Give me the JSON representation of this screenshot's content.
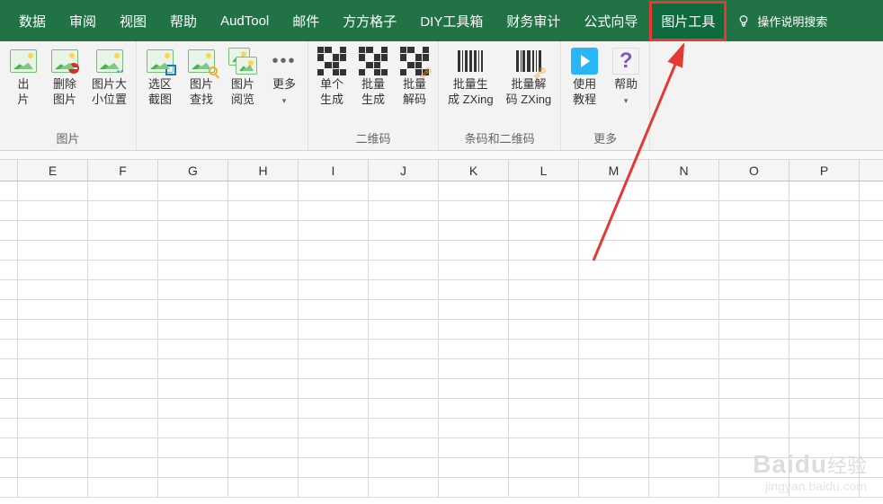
{
  "tabs": {
    "items": [
      {
        "label": "数据"
      },
      {
        "label": "审阅"
      },
      {
        "label": "视图"
      },
      {
        "label": "帮助"
      },
      {
        "label": "AudTool"
      },
      {
        "label": "邮件"
      },
      {
        "label": "方方格子"
      },
      {
        "label": "DIY工具箱"
      },
      {
        "label": "财务审计"
      },
      {
        "label": "公式向导"
      },
      {
        "label": "图片工具",
        "active": true
      }
    ],
    "search": "操作说明搜索"
  },
  "ribbon": {
    "groups": [
      {
        "label": "图片",
        "items": [
          {
            "name": "export-image",
            "label": "出\n片"
          },
          {
            "name": "delete-image",
            "label": "删除\n图片"
          },
          {
            "name": "image-size-pos",
            "label": "图片大\n小位置"
          }
        ]
      },
      {
        "label": "",
        "items": [
          {
            "name": "area-screenshot",
            "label": "选区\n截图"
          },
          {
            "name": "image-search",
            "label": "图片\n查找"
          },
          {
            "name": "image-browse",
            "label": "图片\n阅览"
          },
          {
            "name": "more-1",
            "label": "更多",
            "more": true
          }
        ]
      },
      {
        "label": "二维码",
        "items": [
          {
            "name": "qr-single",
            "label": "单个\n生成"
          },
          {
            "name": "qr-batch",
            "label": "批量\n生成"
          },
          {
            "name": "qr-decode",
            "label": "批量\n解码"
          }
        ]
      },
      {
        "label": "条码和二维码",
        "items": [
          {
            "name": "barcode-batch-gen",
            "label": "批量生\n成 ZXing"
          },
          {
            "name": "barcode-batch-dec",
            "label": "批量解\n码 ZXing"
          }
        ]
      },
      {
        "label": "更多",
        "items": [
          {
            "name": "tutorial",
            "label": "使用\n教程"
          },
          {
            "name": "help",
            "label": "帮助",
            "chevron": true
          }
        ]
      }
    ]
  },
  "columns": [
    "E",
    "F",
    "G",
    "H",
    "I",
    "J",
    "K",
    "L",
    "M",
    "N",
    "O",
    "P"
  ],
  "rows_count": 16,
  "watermark": {
    "brand": "Baidu",
    "cn": "经验",
    "url": "jingyan.baidu.com"
  }
}
